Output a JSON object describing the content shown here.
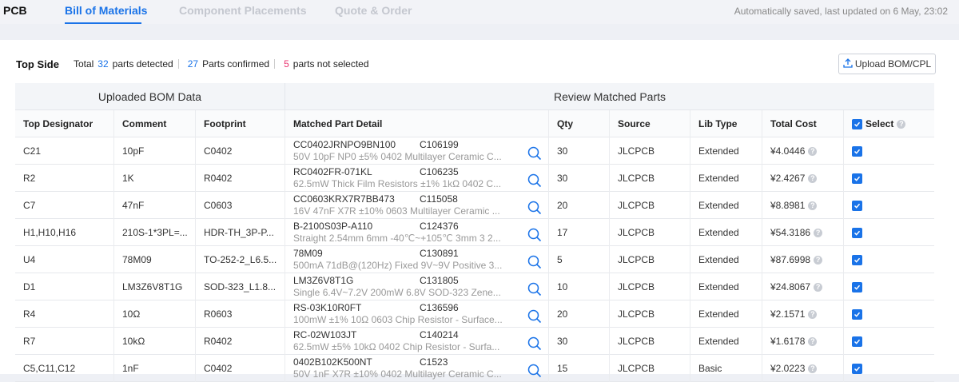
{
  "tabs": [
    {
      "label": "PCB"
    },
    {
      "label": "Bill of Materials"
    },
    {
      "label": "Component Placements"
    },
    {
      "label": "Quote & Order"
    }
  ],
  "status": {
    "saved": "Automatically saved, last updated on 6 May, 23:02"
  },
  "summary": {
    "side": "Top Side",
    "total_label": "Total",
    "detected_count": "32",
    "detected_label": "parts detected",
    "confirmed_count": "27",
    "confirmed_label": "Parts confirmed",
    "not_selected_count": "5",
    "not_selected_label": "parts not selected"
  },
  "upload_button": {
    "label": "Upload BOM/CPL"
  },
  "groups": {
    "left": "Uploaded BOM Data",
    "right": "Review Matched Parts"
  },
  "columns": {
    "designator": "Top Designator",
    "comment": "Comment",
    "footprint": "Footprint",
    "matched": "Matched Part Detail",
    "qty": "Qty",
    "source": "Source",
    "lib_type": "Lib Type",
    "total_cost": "Total Cost",
    "select": "Select"
  },
  "rows": [
    {
      "designator": "C21",
      "comment": "10pF",
      "footprint": "C0402",
      "part_number": "CC0402JRNPO9BN100",
      "lcsc": "C106199",
      "description": "50V 10pF NP0 ±5% 0402 Multilayer Ceramic C...",
      "qty": "30",
      "source": "JLCPCB",
      "lib_type": "Extended",
      "cost": "¥4.0446"
    },
    {
      "designator": "R2",
      "comment": "1K",
      "footprint": "R0402",
      "part_number": "RC0402FR-071KL",
      "lcsc": "C106235",
      "description": "62.5mW Thick Film Resistors ±1% 1kΩ 0402 C...",
      "qty": "30",
      "source": "JLCPCB",
      "lib_type": "Extended",
      "cost": "¥2.4267"
    },
    {
      "designator": "C7",
      "comment": "47nF",
      "footprint": "C0603",
      "part_number": "CC0603KRX7R7BB473",
      "lcsc": "C115058",
      "description": "16V 47nF X7R ±10% 0603 Multilayer Ceramic ...",
      "qty": "20",
      "source": "JLCPCB",
      "lib_type": "Extended",
      "cost": "¥8.8981"
    },
    {
      "designator": "H1,H10,H16",
      "comment": "210S-1*3PL=...",
      "footprint": "HDR-TH_3P-P...",
      "part_number": "B-2100S03P-A110",
      "lcsc": "C124376",
      "description": "Straight 2.54mm 6mm -40℃~+105℃ 3mm 3 2...",
      "qty": "17",
      "source": "JLCPCB",
      "lib_type": "Extended",
      "cost": "¥54.3186"
    },
    {
      "designator": "U4",
      "comment": "78M09",
      "footprint": "TO-252-2_L6.5...",
      "part_number": "78M09",
      "lcsc": "C130891",
      "description": "500mA 71dB@(120Hz) Fixed 9V~9V Positive 3...",
      "qty": "5",
      "source": "JLCPCB",
      "lib_type": "Extended",
      "cost": "¥87.6998"
    },
    {
      "designator": "D1",
      "comment": "LM3Z6V8T1G",
      "footprint": "SOD-323_L1.8...",
      "part_number": "LM3Z6V8T1G",
      "lcsc": "C131805",
      "description": "Single 6.4V~7.2V 200mW 6.8V SOD-323 Zene...",
      "qty": "10",
      "source": "JLCPCB",
      "lib_type": "Extended",
      "cost": "¥24.8067"
    },
    {
      "designator": "R4",
      "comment": "10Ω",
      "footprint": "R0603",
      "part_number": "RS-03K10R0FT",
      "lcsc": "C136596",
      "description": "100mW ±1% 10Ω 0603 Chip Resistor - Surface...",
      "qty": "20",
      "source": "JLCPCB",
      "lib_type": "Extended",
      "cost": "¥2.1571"
    },
    {
      "designator": "R7",
      "comment": "10kΩ",
      "footprint": "R0402",
      "part_number": "RC-02W103JT",
      "lcsc": "C140214",
      "description": "62.5mW ±5% 10kΩ 0402 Chip Resistor - Surfa...",
      "qty": "30",
      "source": "JLCPCB",
      "lib_type": "Extended",
      "cost": "¥1.6178"
    },
    {
      "designator": "C5,C11,C12",
      "comment": "1nF",
      "footprint": "C0402",
      "part_number": "0402B102K500NT",
      "lcsc": "C1523",
      "description": "50V 1nF X7R ±10% 0402 Multilayer Ceramic C...",
      "qty": "15",
      "source": "JLCPCB",
      "lib_type": "Basic",
      "cost": "¥2.0223"
    }
  ],
  "colors": {
    "accent": "#1a73e8",
    "alert": "#e8336f"
  }
}
